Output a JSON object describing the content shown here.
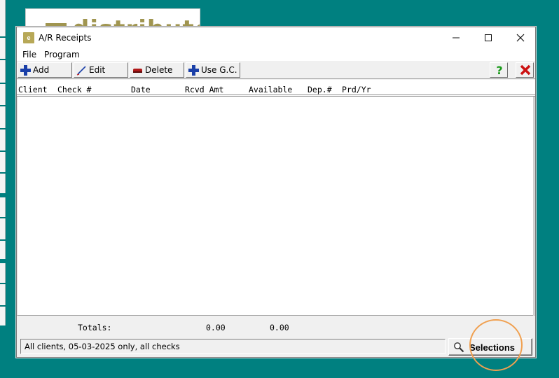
{
  "background": {
    "logo_text": "distributor"
  },
  "window": {
    "title": "A/R Receipts",
    "icon_label": "e",
    "controls": {
      "minimize": "—",
      "maximize": "",
      "close": "✕"
    }
  },
  "menu": {
    "file": "File",
    "program": "Program"
  },
  "toolbar": {
    "add": "Add",
    "edit": "Edit",
    "delete": "Delete",
    "use_gc": "Use G.C."
  },
  "table": {
    "columns": [
      "Client",
      "Check #",
      "Date",
      "Rcvd Amt",
      "Available",
      "Dep.#",
      "Prd/Yr"
    ],
    "rows": []
  },
  "totals": {
    "label": "Totals:",
    "rcvd_amt": "0.00",
    "available": "0.00"
  },
  "status": {
    "text": "All clients, 05-03-2025 only, all checks"
  },
  "selections_button": {
    "label": "Selections"
  },
  "colors": {
    "desktop": "#008080",
    "logo_gold": "#a09550",
    "highlight": "#f0a050",
    "add_icon": "#1a3fa8",
    "help_icon": "#1a9a1a",
    "exit_icon": "#cc1111"
  }
}
